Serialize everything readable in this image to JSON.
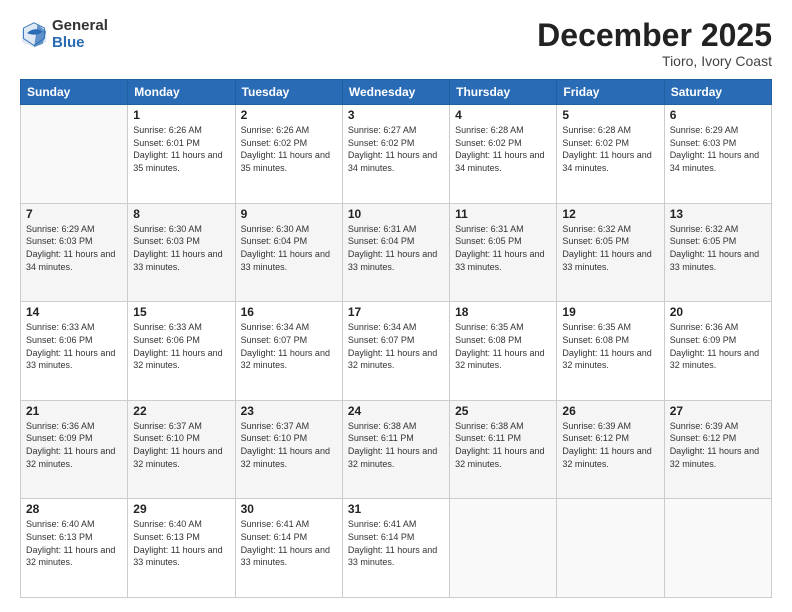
{
  "logo": {
    "general": "General",
    "blue": "Blue"
  },
  "title": "December 2025",
  "subtitle": "Tioro, Ivory Coast",
  "days_header": [
    "Sunday",
    "Monday",
    "Tuesday",
    "Wednesday",
    "Thursday",
    "Friday",
    "Saturday"
  ],
  "weeks": [
    [
      {
        "day": "",
        "sunrise": "",
        "sunset": "",
        "daylight": ""
      },
      {
        "day": "1",
        "sunrise": "Sunrise: 6:26 AM",
        "sunset": "Sunset: 6:01 PM",
        "daylight": "Daylight: 11 hours and 35 minutes."
      },
      {
        "day": "2",
        "sunrise": "Sunrise: 6:26 AM",
        "sunset": "Sunset: 6:02 PM",
        "daylight": "Daylight: 11 hours and 35 minutes."
      },
      {
        "day": "3",
        "sunrise": "Sunrise: 6:27 AM",
        "sunset": "Sunset: 6:02 PM",
        "daylight": "Daylight: 11 hours and 34 minutes."
      },
      {
        "day": "4",
        "sunrise": "Sunrise: 6:28 AM",
        "sunset": "Sunset: 6:02 PM",
        "daylight": "Daylight: 11 hours and 34 minutes."
      },
      {
        "day": "5",
        "sunrise": "Sunrise: 6:28 AM",
        "sunset": "Sunset: 6:02 PM",
        "daylight": "Daylight: 11 hours and 34 minutes."
      },
      {
        "day": "6",
        "sunrise": "Sunrise: 6:29 AM",
        "sunset": "Sunset: 6:03 PM",
        "daylight": "Daylight: 11 hours and 34 minutes."
      }
    ],
    [
      {
        "day": "7",
        "sunrise": "Sunrise: 6:29 AM",
        "sunset": "Sunset: 6:03 PM",
        "daylight": "Daylight: 11 hours and 34 minutes."
      },
      {
        "day": "8",
        "sunrise": "Sunrise: 6:30 AM",
        "sunset": "Sunset: 6:03 PM",
        "daylight": "Daylight: 11 hours and 33 minutes."
      },
      {
        "day": "9",
        "sunrise": "Sunrise: 6:30 AM",
        "sunset": "Sunset: 6:04 PM",
        "daylight": "Daylight: 11 hours and 33 minutes."
      },
      {
        "day": "10",
        "sunrise": "Sunrise: 6:31 AM",
        "sunset": "Sunset: 6:04 PM",
        "daylight": "Daylight: 11 hours and 33 minutes."
      },
      {
        "day": "11",
        "sunrise": "Sunrise: 6:31 AM",
        "sunset": "Sunset: 6:05 PM",
        "daylight": "Daylight: 11 hours and 33 minutes."
      },
      {
        "day": "12",
        "sunrise": "Sunrise: 6:32 AM",
        "sunset": "Sunset: 6:05 PM",
        "daylight": "Daylight: 11 hours and 33 minutes."
      },
      {
        "day": "13",
        "sunrise": "Sunrise: 6:32 AM",
        "sunset": "Sunset: 6:05 PM",
        "daylight": "Daylight: 11 hours and 33 minutes."
      }
    ],
    [
      {
        "day": "14",
        "sunrise": "Sunrise: 6:33 AM",
        "sunset": "Sunset: 6:06 PM",
        "daylight": "Daylight: 11 hours and 33 minutes."
      },
      {
        "day": "15",
        "sunrise": "Sunrise: 6:33 AM",
        "sunset": "Sunset: 6:06 PM",
        "daylight": "Daylight: 11 hours and 32 minutes."
      },
      {
        "day": "16",
        "sunrise": "Sunrise: 6:34 AM",
        "sunset": "Sunset: 6:07 PM",
        "daylight": "Daylight: 11 hours and 32 minutes."
      },
      {
        "day": "17",
        "sunrise": "Sunrise: 6:34 AM",
        "sunset": "Sunset: 6:07 PM",
        "daylight": "Daylight: 11 hours and 32 minutes."
      },
      {
        "day": "18",
        "sunrise": "Sunrise: 6:35 AM",
        "sunset": "Sunset: 6:08 PM",
        "daylight": "Daylight: 11 hours and 32 minutes."
      },
      {
        "day": "19",
        "sunrise": "Sunrise: 6:35 AM",
        "sunset": "Sunset: 6:08 PM",
        "daylight": "Daylight: 11 hours and 32 minutes."
      },
      {
        "day": "20",
        "sunrise": "Sunrise: 6:36 AM",
        "sunset": "Sunset: 6:09 PM",
        "daylight": "Daylight: 11 hours and 32 minutes."
      }
    ],
    [
      {
        "day": "21",
        "sunrise": "Sunrise: 6:36 AM",
        "sunset": "Sunset: 6:09 PM",
        "daylight": "Daylight: 11 hours and 32 minutes."
      },
      {
        "day": "22",
        "sunrise": "Sunrise: 6:37 AM",
        "sunset": "Sunset: 6:10 PM",
        "daylight": "Daylight: 11 hours and 32 minutes."
      },
      {
        "day": "23",
        "sunrise": "Sunrise: 6:37 AM",
        "sunset": "Sunset: 6:10 PM",
        "daylight": "Daylight: 11 hours and 32 minutes."
      },
      {
        "day": "24",
        "sunrise": "Sunrise: 6:38 AM",
        "sunset": "Sunset: 6:11 PM",
        "daylight": "Daylight: 11 hours and 32 minutes."
      },
      {
        "day": "25",
        "sunrise": "Sunrise: 6:38 AM",
        "sunset": "Sunset: 6:11 PM",
        "daylight": "Daylight: 11 hours and 32 minutes."
      },
      {
        "day": "26",
        "sunrise": "Sunrise: 6:39 AM",
        "sunset": "Sunset: 6:12 PM",
        "daylight": "Daylight: 11 hours and 32 minutes."
      },
      {
        "day": "27",
        "sunrise": "Sunrise: 6:39 AM",
        "sunset": "Sunset: 6:12 PM",
        "daylight": "Daylight: 11 hours and 32 minutes."
      }
    ],
    [
      {
        "day": "28",
        "sunrise": "Sunrise: 6:40 AM",
        "sunset": "Sunset: 6:13 PM",
        "daylight": "Daylight: 11 hours and 32 minutes."
      },
      {
        "day": "29",
        "sunrise": "Sunrise: 6:40 AM",
        "sunset": "Sunset: 6:13 PM",
        "daylight": "Daylight: 11 hours and 33 minutes."
      },
      {
        "day": "30",
        "sunrise": "Sunrise: 6:41 AM",
        "sunset": "Sunset: 6:14 PM",
        "daylight": "Daylight: 11 hours and 33 minutes."
      },
      {
        "day": "31",
        "sunrise": "Sunrise: 6:41 AM",
        "sunset": "Sunset: 6:14 PM",
        "daylight": "Daylight: 11 hours and 33 minutes."
      },
      {
        "day": "",
        "sunrise": "",
        "sunset": "",
        "daylight": ""
      },
      {
        "day": "",
        "sunrise": "",
        "sunset": "",
        "daylight": ""
      },
      {
        "day": "",
        "sunrise": "",
        "sunset": "",
        "daylight": ""
      }
    ]
  ]
}
